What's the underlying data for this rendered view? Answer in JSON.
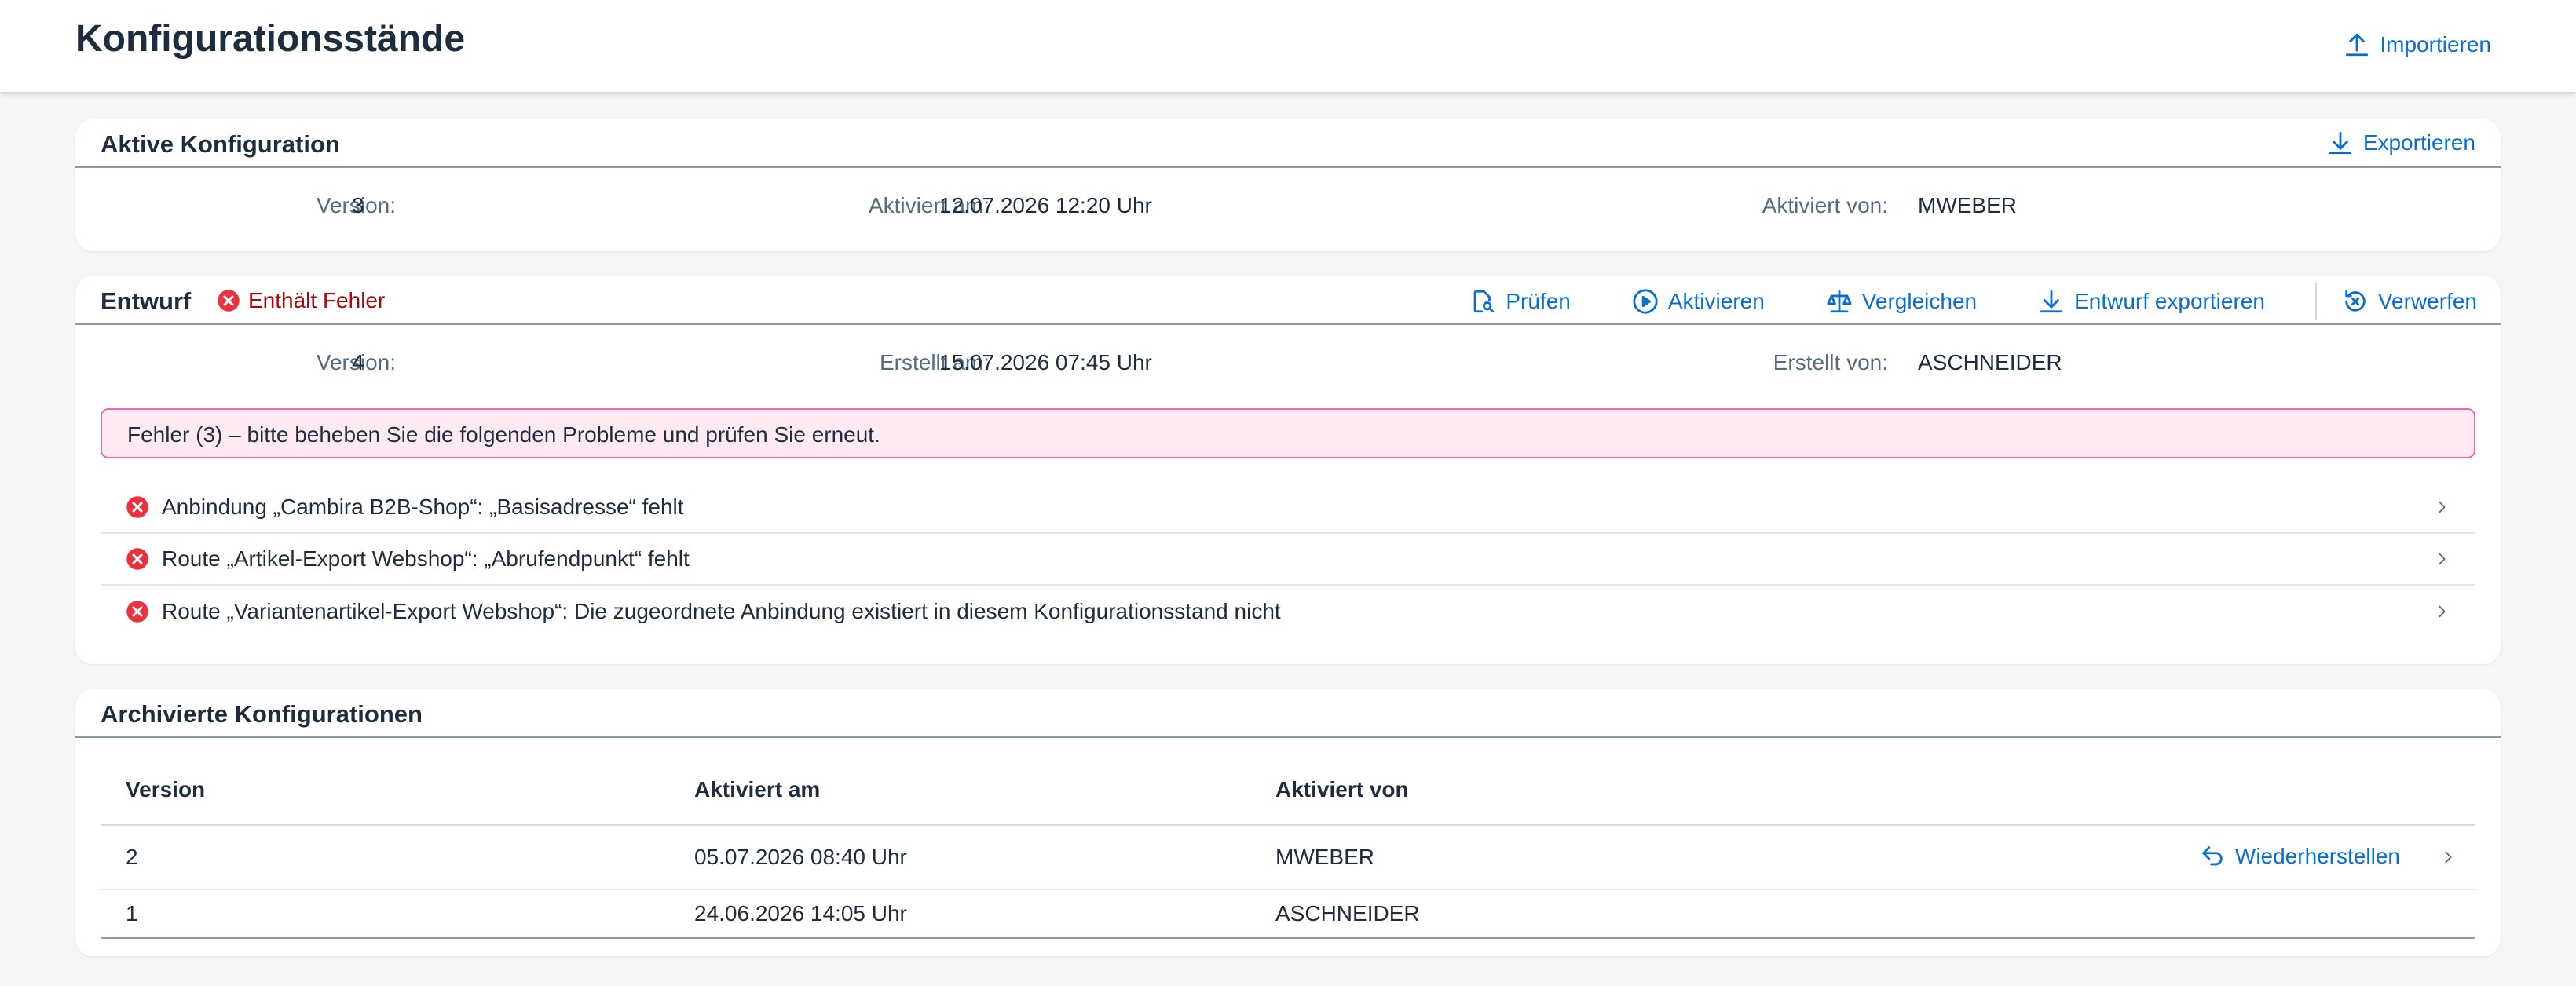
{
  "page": {
    "title": "Konfigurationsstände",
    "import_label": "Importieren"
  },
  "colors": {
    "accent": "#0a6ed1",
    "error": "#aa0808",
    "error_icon": "#e9323b",
    "error_strip_bg": "#ffeaf4",
    "error_strip_border": "#e56dae"
  },
  "active": {
    "title": "Aktive Konfiguration",
    "export_label": "Exportieren",
    "version_label": "Version:",
    "version_value": "3",
    "activated_at_label": "Aktiviert am:",
    "activated_at_value": "12.07.2026 12:20 Uhr",
    "activated_by_label": "Aktiviert von:",
    "activated_by_value": "MWEBER"
  },
  "draft": {
    "title": "Entwurf",
    "status": "Enthält Fehler",
    "toolbar": {
      "check": "Prüfen",
      "activate": "Aktivieren",
      "compare": "Vergleichen",
      "export": "Entwurf exportieren",
      "discard": "Verwerfen"
    },
    "version_label": "Version:",
    "version_value": "4",
    "created_at_label": "Erstellt am:",
    "created_at_value": "15.07.2026 07:45 Uhr",
    "created_by_label": "Erstellt von:",
    "created_by_value": "ASCHNEIDER",
    "message": "Fehler (3) – bitte beheben Sie die folgenden Probleme und prüfen Sie erneut.",
    "issues": [
      "Anbindung „Cambira B2B-Shop“: „Basisadresse“ fehlt",
      "Route „Artikel-Export Webshop“: „Abrufendpunkt“ fehlt",
      "Route „Variantenartikel-Export Webshop“: Die zugeordnete Anbindung existiert in diesem Konfigurationsstand nicht"
    ]
  },
  "archive": {
    "title": "Archivierte Konfigurationen",
    "columns": [
      "Version",
      "Aktiviert am",
      "Aktiviert von"
    ],
    "restore_label": "Wiederherstellen",
    "rows": [
      {
        "version": "2",
        "activated_at": "05.07.2026 08:40 Uhr",
        "activated_by": "MWEBER"
      },
      {
        "version": "1",
        "activated_at": "24.06.2026 14:05 Uhr",
        "activated_by": "ASCHNEIDER"
      }
    ]
  }
}
